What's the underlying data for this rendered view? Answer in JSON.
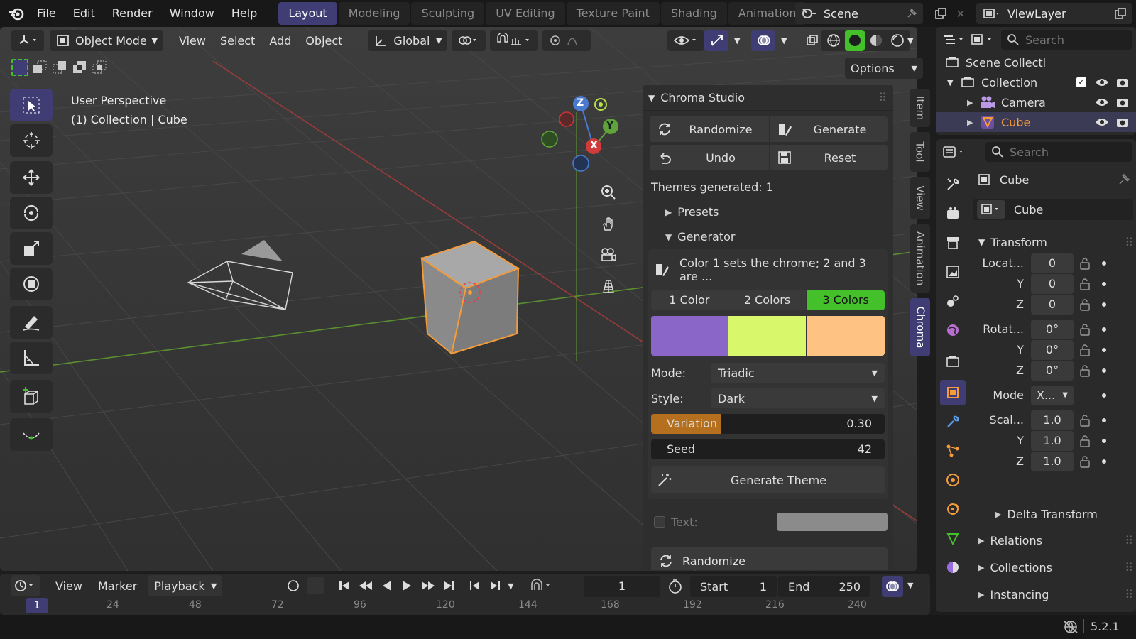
{
  "menu": {
    "file": "File",
    "edit": "Edit",
    "render": "Render",
    "window": "Window",
    "help": "Help"
  },
  "workspaces": [
    "Layout",
    "Modeling",
    "Sculpting",
    "UV Editing",
    "Texture Paint",
    "Shading",
    "Animation"
  ],
  "scene_name": "Scene",
  "view_layer": "ViewLayer",
  "viewport_header": {
    "mode": "Object Mode",
    "view": "View",
    "select": "Select",
    "add": "Add",
    "object": "Object",
    "orientation": "Global",
    "options": "Options"
  },
  "overlay_text": {
    "perspective": "User Perspective",
    "collection_info": "(1) Collection | Cube"
  },
  "gizmo": {
    "x": "X",
    "y": "Y",
    "z": "Z"
  },
  "npanel": {
    "title": "Chroma Studio",
    "randomize": "Randomize",
    "generate": "Generate",
    "undo": "Undo",
    "reset": "Reset",
    "themes_generated": "Themes generated: 1",
    "presets": "Presets",
    "generator": "Generator",
    "hint": "Color 1 sets the chrome; 2 and 3 are ...",
    "color_tabs": [
      "1 Color",
      "2 Colors",
      "3 Colors"
    ],
    "swatches": [
      "#8a66c8",
      "#d9f76a",
      "#fec382"
    ],
    "mode_label": "Mode:",
    "mode_value": "Triadic",
    "style_label": "Style:",
    "style_value": "Dark",
    "variation_label": "Variation",
    "variation_value": "0.30",
    "variation_fraction": 0.3,
    "seed_label": "Seed",
    "seed_value": "42",
    "generate_theme": "Generate Theme",
    "text_label": "Text:",
    "randomize2": "Randomize"
  },
  "side_tabs": [
    "Item",
    "Tool",
    "View",
    "Animation",
    "Chroma"
  ],
  "outliner": {
    "search": "Search",
    "scene_collection": "Scene Collecti",
    "collection": "Collection",
    "camera": "Camera",
    "cube": "Cube"
  },
  "properties": {
    "search": "Search",
    "object_name": "Cube",
    "data_name": "Cube",
    "transform": "Transform",
    "location_label": "Locat...",
    "rotation_label": "Rotat...",
    "scale_label": "Scal...",
    "y": "Y",
    "z": "Z",
    "loc": [
      "0",
      "0",
      "0"
    ],
    "rot": [
      "0°",
      "0°",
      "0°"
    ],
    "scale": [
      "1.0",
      "1.0",
      "1.0"
    ],
    "mode_label": "Mode",
    "mode_value": "X...",
    "delta": "Delta Transform",
    "relations": "Relations",
    "collections": "Collections",
    "instancing": "Instancing"
  },
  "timeline": {
    "view": "View",
    "marker": "Marker",
    "playback": "Playback",
    "current_frame": "1",
    "start_label": "Start",
    "start": "1",
    "end_label": "End",
    "end": "250",
    "ruler": [
      "1",
      "24",
      "48",
      "72",
      "96",
      "120",
      "144",
      "168",
      "192",
      "216",
      "240"
    ]
  },
  "version": "5.2.1",
  "colors": {
    "accent": "#3f3d73",
    "selection": "#f49b3b",
    "header": "#181818",
    "panel": "#2e2e2e",
    "active_green": "#44c02a"
  }
}
